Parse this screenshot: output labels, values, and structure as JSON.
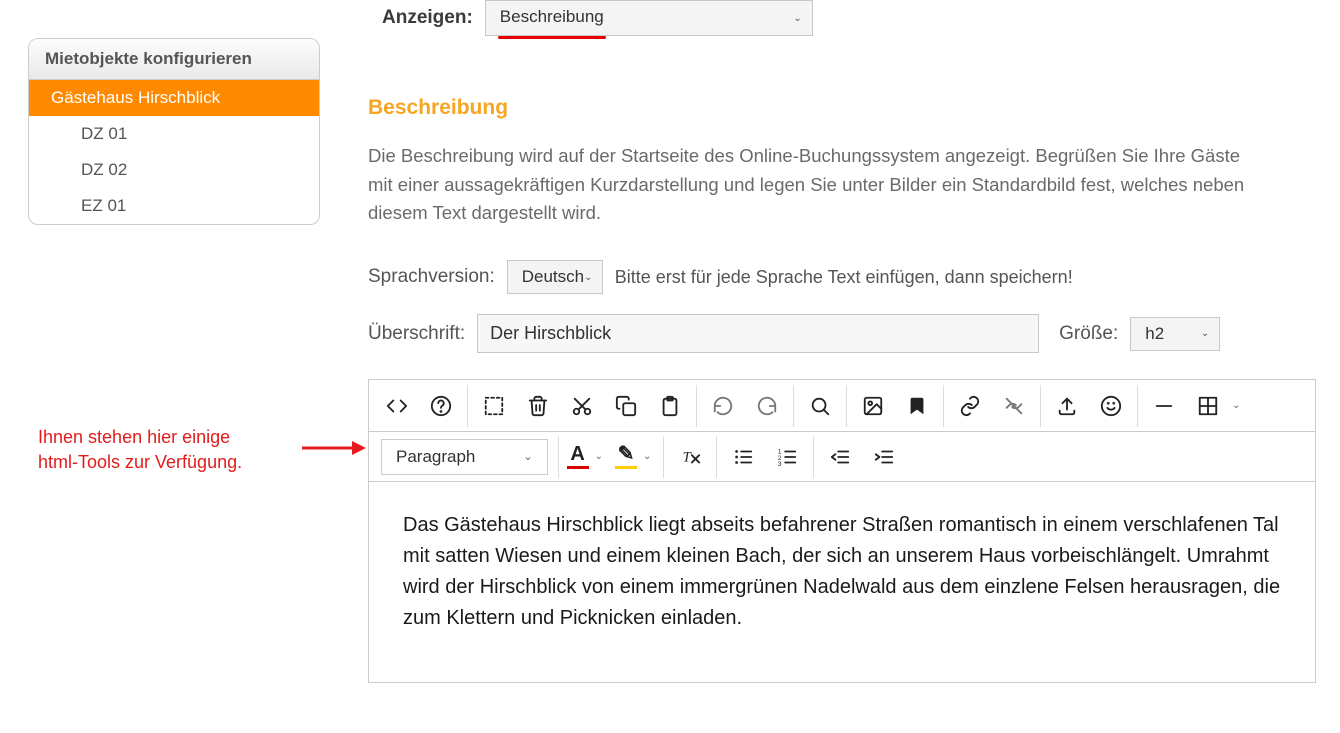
{
  "sidebar": {
    "title": "Mietobjekte konfigurieren",
    "items": [
      {
        "label": "Gästehaus Hirschblick",
        "active": true,
        "child": false
      },
      {
        "label": "DZ 01",
        "active": false,
        "child": true
      },
      {
        "label": "DZ 02",
        "active": false,
        "child": true
      },
      {
        "label": "EZ 01",
        "active": false,
        "child": true
      }
    ]
  },
  "annotation": {
    "line1": "Ihnen stehen hier einige",
    "line2": "html-Tools zur Verfügung."
  },
  "anzeigen": {
    "label": "Anzeigen:",
    "selected": "Beschreibung"
  },
  "section": {
    "heading": "Beschreibung"
  },
  "info_text": "Die Beschreibung wird auf der Startseite des Online-Buchungssystem angezeigt. Begrüßen Sie Ihre Gäste mit einer aussagekräftigen Kurzdarstellung und legen Sie unter Bilder ein Standardbild fest, welches neben diesem Text dargestellt wird.",
  "sprach": {
    "label": "Sprachversion:",
    "selected": "Deutsch",
    "hint": "Bitte erst für jede Sprache Text einfügen, dann speichern!"
  },
  "ueberschrift": {
    "label": "Überschrift:",
    "value": "Der Hirschblick",
    "size_label": "Größe:",
    "size_value": "h2"
  },
  "editor": {
    "format_selected": "Paragraph",
    "content": "Das Gästehaus Hirschblick liegt abseits befahrener Straßen romantisch in einem verschlafenen Tal mit satten Wiesen und einem kleinen Bach, der sich an unserem Haus vorbeischlängelt. Umrahmt wird der Hirschblick von einem immergrünen Nadelwald aus dem einzlene Felsen herausragen, die zum Klettern und Picknicken einladen."
  }
}
